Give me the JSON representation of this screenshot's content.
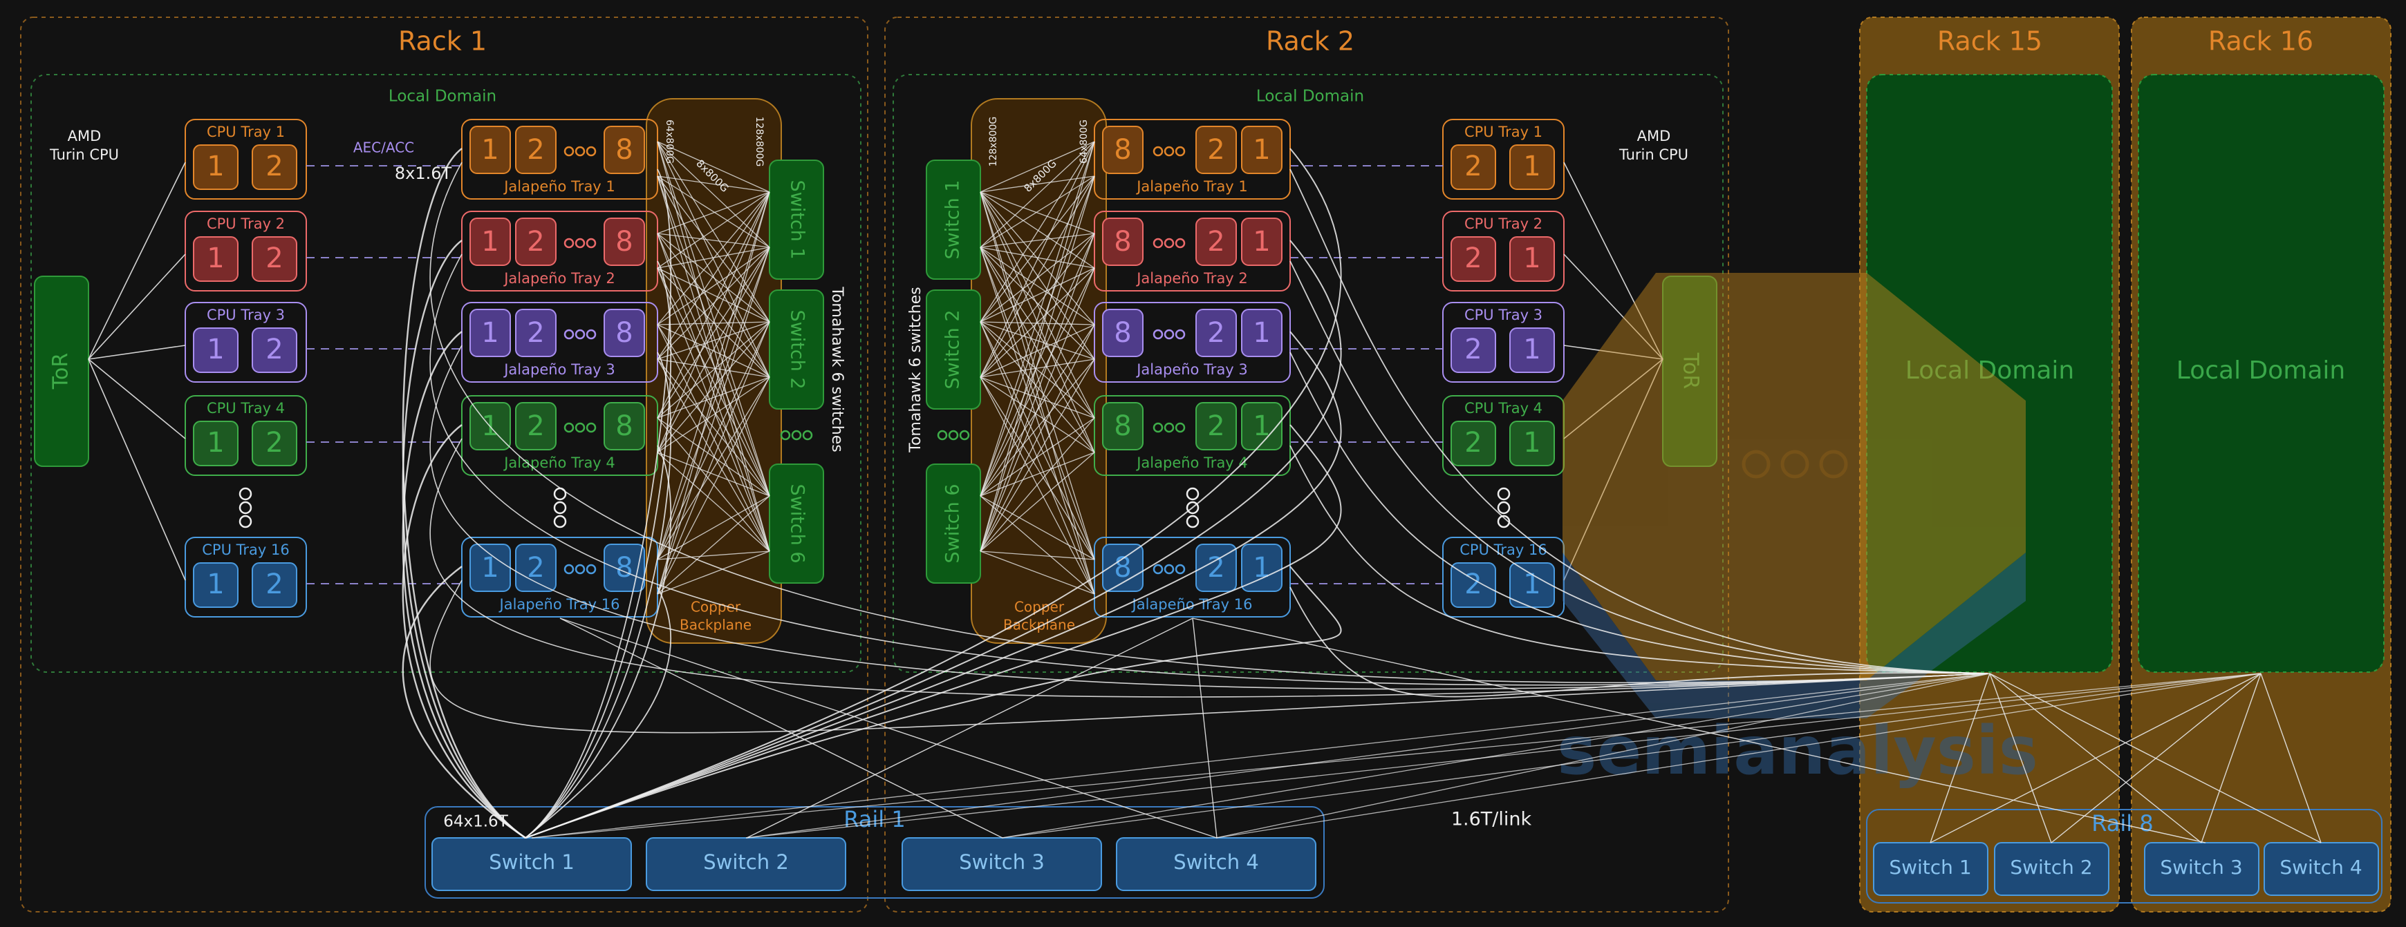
{
  "racks": {
    "rack1": {
      "title": "Rack 1",
      "local_domain": "Local Domain",
      "cpu_label": [
        "AMD",
        "Turin CPU"
      ],
      "tor": "ToR",
      "aec_label": "AEC/ACC",
      "uplink_label": "8x1.6T",
      "backplane": [
        "Copper",
        "Backplane"
      ],
      "tomahawk": "Tomahawk 6 switches",
      "bp_labels": [
        "64x800G",
        "8x800G",
        "128x800G"
      ]
    },
    "rack2": {
      "title": "Rack 2",
      "local_domain": "Local Domain",
      "cpu_label": [
        "AMD",
        "Turin CPU"
      ],
      "tor": "ToR",
      "backplane": [
        "Copper",
        "Backplane"
      ],
      "tomahawk": "Tomahawk 6 switches",
      "bp_labels": [
        "128x800G",
        "8x800G",
        "64x800G"
      ]
    },
    "rack15": {
      "title": "Rack 15",
      "local_domain": "Local Domain"
    },
    "rack16": {
      "title": "Rack 16",
      "local_domain": "Local Domain"
    }
  },
  "cpu_trays": [
    {
      "label": "CPU Tray 1",
      "color": "#e3862a",
      "fill": "#6e3d10"
    },
    {
      "label": "CPU Tray 2",
      "color": "#ec6a6a",
      "fill": "#7a2a2a"
    },
    {
      "label": "CPU Tray 3",
      "color": "#a98ff0",
      "fill": "#4f3c8a"
    },
    {
      "label": "CPU Tray 4",
      "color": "#3fae4a",
      "fill": "#1d5a22"
    },
    {
      "label": "CPU Tray 16",
      "color": "#4a9be0",
      "fill": "#1d4a78"
    }
  ],
  "jalapeno_trays": [
    "Jalapeño Tray 1",
    "Jalapeño Tray 2",
    "Jalapeño Tray 3",
    "Jalapeño Tray 4",
    "Jalapeño Tray 16"
  ],
  "chips": {
    "first": "1",
    "second": "2",
    "last": "8"
  },
  "switches_left": [
    "Switch 1",
    "Switch 2",
    "Switch 6"
  ],
  "switches_right": [
    "Switch 1",
    "Switch 2",
    "Switch 6"
  ],
  "rail1": {
    "title": "Rail 1",
    "label": "64x1.6T",
    "switches": [
      "Switch 1",
      "Switch 2",
      "Switch 3",
      "Switch 4"
    ]
  },
  "rail8": {
    "title": "Rail 8",
    "switches": [
      "Switch 1",
      "Switch 2",
      "Switch 3",
      "Switch 4"
    ]
  },
  "link_label": "1.6T/link",
  "watermark": "semianalysis",
  "colors": {
    "orange": "#e3862a",
    "green": "#3fae4a",
    "blue": "#4a9be0",
    "line": "#e8e8e8",
    "dash": "#9a8fe0"
  }
}
